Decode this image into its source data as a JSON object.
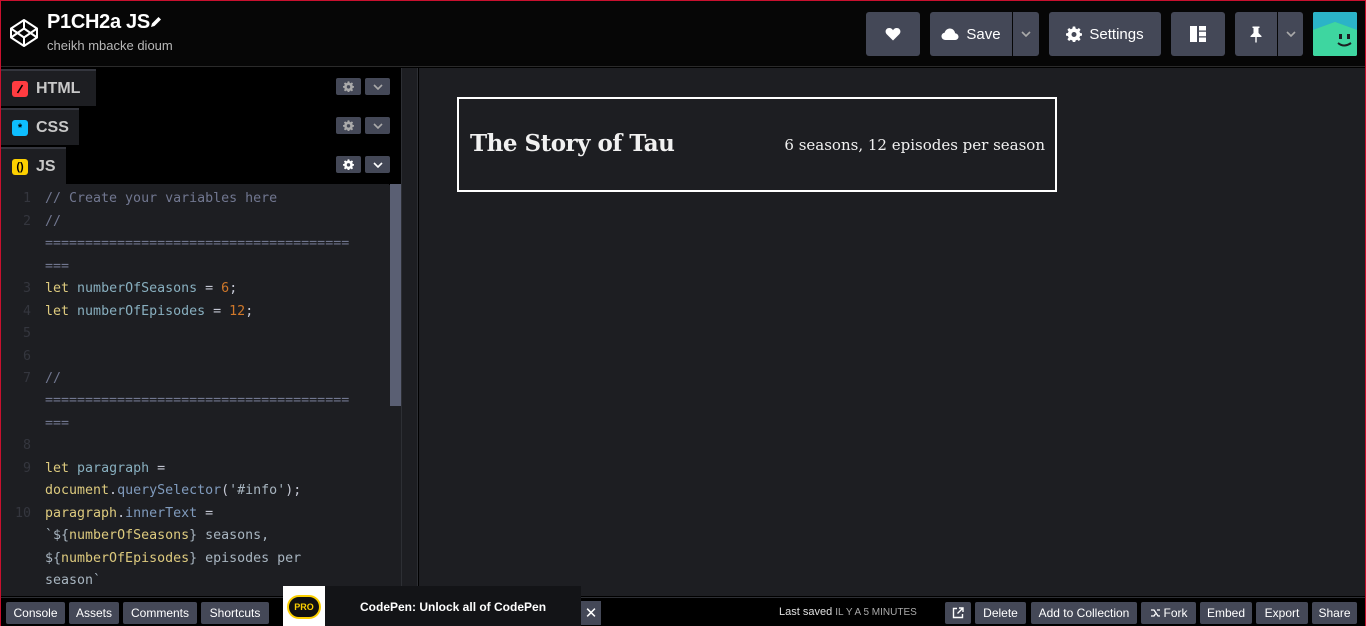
{
  "header": {
    "title": "P1CH2a JS",
    "author": "cheikh mbacke dioum",
    "save_label": "Save",
    "settings_label": "Settings"
  },
  "editors": {
    "html_label": "HTML",
    "css_label": "CSS",
    "js_label": "JS"
  },
  "code": {
    "line_numbers": [
      "1",
      "2",
      "3",
      "4",
      "5",
      "6",
      "7",
      "8",
      "9",
      "10"
    ],
    "l1": "// Create your variables here",
    "l2a": "//",
    "l2b": "======================================",
    "l2c": "===",
    "l3_kw": "let",
    "l3_var": "numberOfSeasons",
    "l3_eq": " = ",
    "l3_num": "6",
    "l3_end": ";",
    "l4_kw": "let",
    "l4_var": "numberOfEpisodes",
    "l4_eq": " = ",
    "l4_num": "12",
    "l4_end": ";",
    "l7a": "//",
    "l7b": "======================================",
    "l7c": "===",
    "l9_kw": "let",
    "l9_var": "paragraph",
    "l9_eq": " =",
    "l9b_obj": "document",
    "l9b_dot": ".",
    "l9b_fn": "querySelector",
    "l9b_open": "(",
    "l9b_str": "'#info'",
    "l9b_close": ");",
    "l10_obj": "paragraph",
    "l10_dot": ".",
    "l10_prop": "innerText",
    "l10_eq": " =",
    "l10b_tick": "`${",
    "l10b_var": "numberOfSeasons",
    "l10b_rest": "} seasons,",
    "l10c_open": "${",
    "l10c_var": "numberOfEpisodes",
    "l10c_rest": "} episodes per",
    "l10d": "season`"
  },
  "preview": {
    "card_title": "The Story of Tau",
    "card_info": "6 seasons, 12 episodes per season"
  },
  "footer": {
    "console": "Console",
    "assets": "Assets",
    "comments": "Comments",
    "shortcuts": "Shortcuts",
    "promo_badge": "PRO",
    "promo_text": "CodePen: Unlock all of CodePen",
    "close": "✕",
    "last_saved": "Last saved",
    "saved_time": "IL Y A 5 MINUTES",
    "delete": "Delete",
    "add_collection": "Add to Collection",
    "fork": "Fork",
    "embed": "Embed",
    "export": "Export",
    "share": "Share"
  },
  "colors": {
    "accent_html": "#ff3c41",
    "accent_css": "#0ebeff",
    "accent_js": "#fcd000",
    "button_bg": "#444857"
  }
}
